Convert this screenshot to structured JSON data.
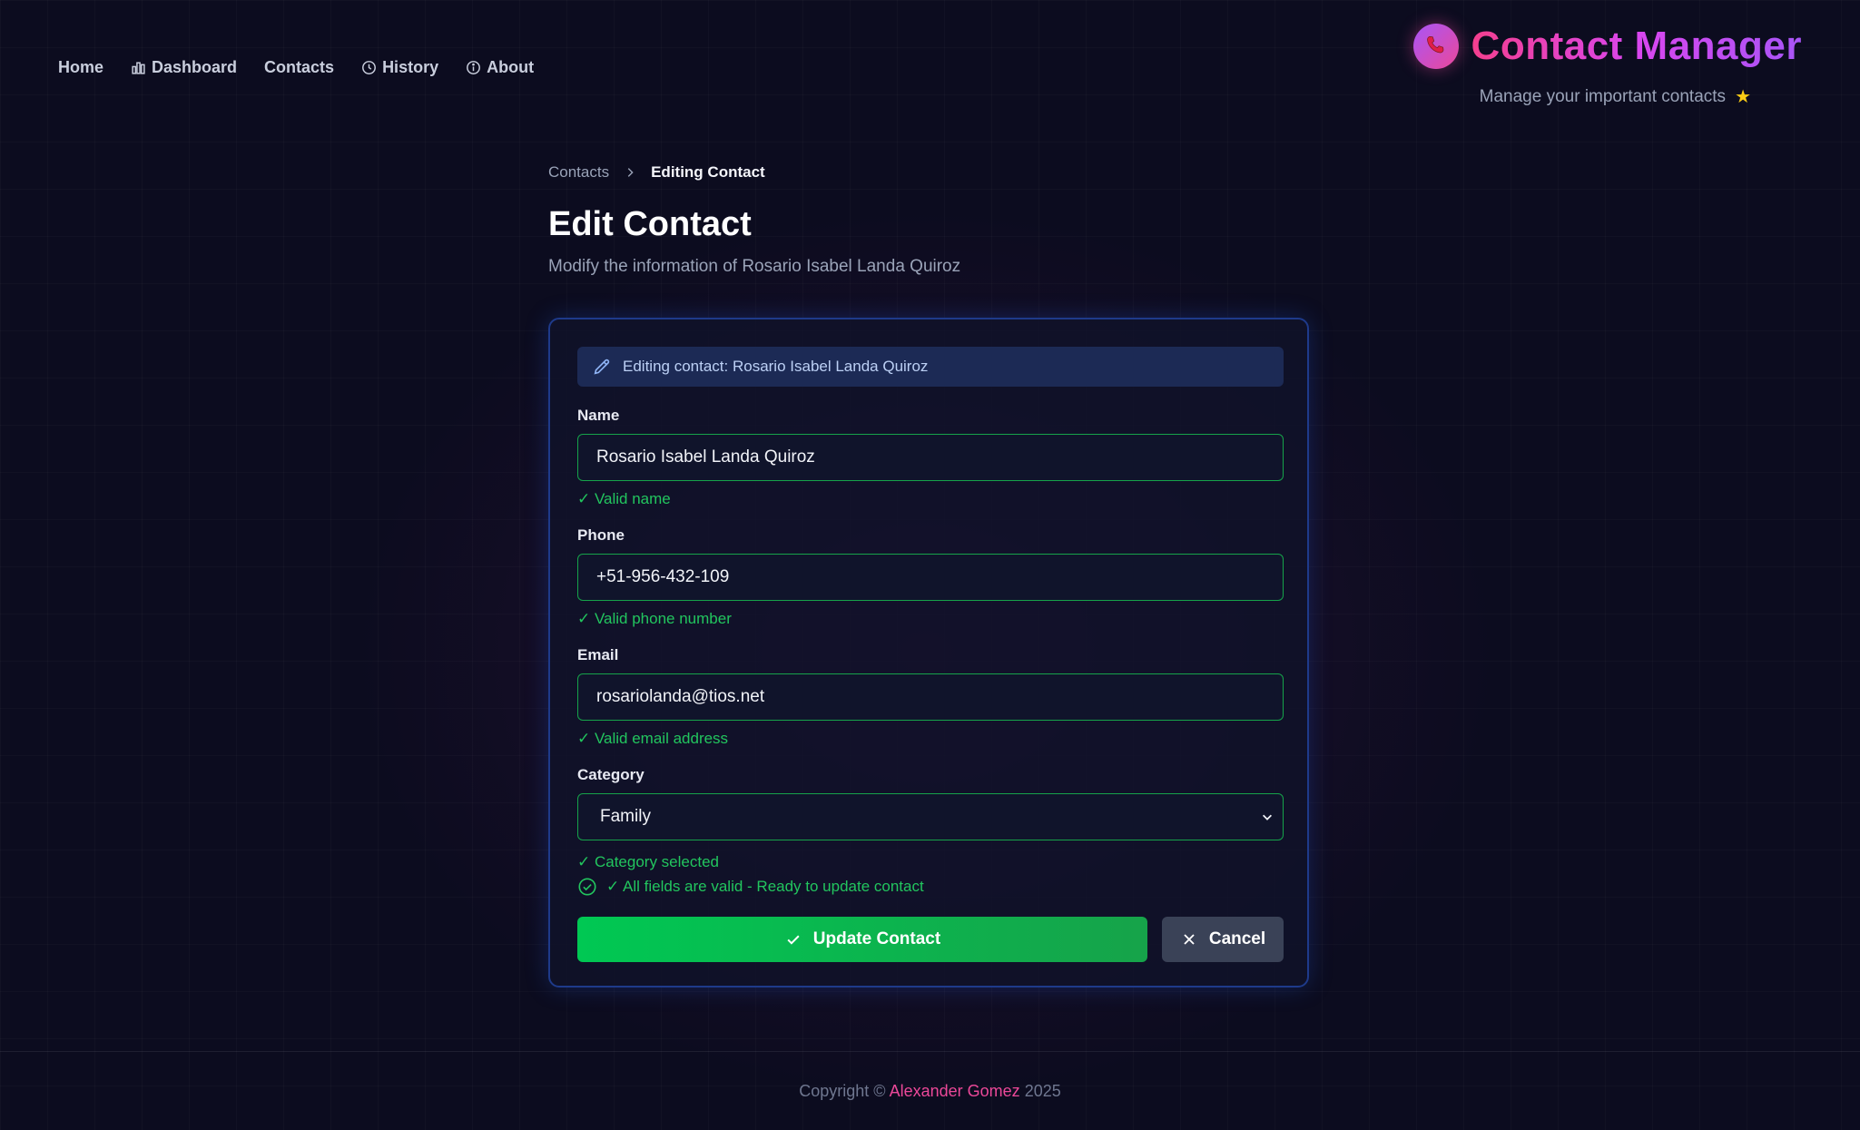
{
  "nav": {
    "items": [
      {
        "label": "Home",
        "icon": ""
      },
      {
        "label": "Dashboard",
        "icon": "chart-icon"
      },
      {
        "label": "Contacts",
        "icon": ""
      },
      {
        "label": "History",
        "icon": "clock-icon"
      },
      {
        "label": "About",
        "icon": "info-icon"
      }
    ]
  },
  "brand": {
    "title": "Contact Manager",
    "subtitle": "Manage your important contacts",
    "star": "★",
    "logo_icon": "phone-icon"
  },
  "breadcrumb": {
    "parent": "Contacts",
    "current": "Editing Contact"
  },
  "page": {
    "title": "Edit Contact",
    "subtitle": "Modify the information of Rosario Isabel Landa Quiroz"
  },
  "form": {
    "info": "Editing contact: Rosario Isabel Landa Quiroz",
    "name": {
      "label": "Name",
      "value": "Rosario Isabel Landa Quiroz",
      "status": "✓ Valid name"
    },
    "phone": {
      "label": "Phone",
      "value": "+51-956-432-109",
      "status": "✓ Valid phone number"
    },
    "email": {
      "label": "Email",
      "value": "rosariolanda@tios.net",
      "status": "✓ Valid email address"
    },
    "category": {
      "label": "Category",
      "value": "Family",
      "status": "✓ Category selected"
    },
    "all_valid": "✓ All fields are valid - Ready to update contact",
    "update_label": "Update Contact",
    "cancel_label": "Cancel"
  },
  "footer": {
    "prefix": "Copyright ©",
    "author": "Alexander Gomez",
    "year": "2025"
  },
  "colors": {
    "valid": "#22c55e",
    "accent": "#ec4899",
    "primary_button": "#00c853",
    "card_border": "#1e3a8a"
  }
}
